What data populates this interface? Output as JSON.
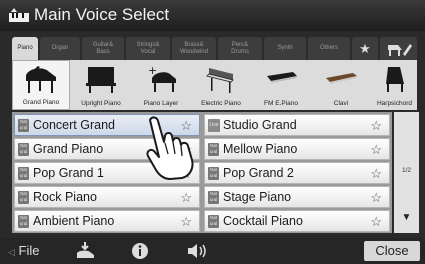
{
  "title": "Main Voice Select",
  "tabs": [
    {
      "label": "Piano",
      "active": true
    },
    {
      "label": "Organ",
      "active": false
    },
    {
      "label": "Guitar&\nBass",
      "active": false
    },
    {
      "label": "Strings&\nVocal",
      "active": false
    },
    {
      "label": "Brass&\nWoodwind",
      "active": false
    },
    {
      "label": "Perc&\nDrums",
      "active": false
    },
    {
      "label": "Synth",
      "active": false
    },
    {
      "label": "Others",
      "active": false
    }
  ],
  "categories": [
    {
      "label": "Grand Piano",
      "icon": "grand-piano-icon",
      "active": true
    },
    {
      "label": "Upright Piano",
      "icon": "upright-piano-icon"
    },
    {
      "label": "Piano Layer",
      "icon": "piano-layer-icon"
    },
    {
      "label": "Electric Piano",
      "icon": "electric-piano-icon"
    },
    {
      "label": "FM E.Piano",
      "icon": "fm-epiano-icon"
    },
    {
      "label": "Clavi",
      "icon": "clavi-icon"
    },
    {
      "label": "Harpsichord",
      "icon": "harpsichord-icon"
    }
  ],
  "voices_left": [
    {
      "name": "Concert Grand",
      "badge": "Nat\nural",
      "selected": true
    },
    {
      "name": "Grand Piano",
      "badge": "Nat\nural"
    },
    {
      "name": "Pop Grand 1",
      "badge": "Nat\nural"
    },
    {
      "name": "Rock Piano",
      "badge": "Nat\nural"
    },
    {
      "name": "Ambient Piano",
      "badge": "Nat\nural"
    }
  ],
  "voices_right": [
    {
      "name": "Studio Grand",
      "badge": "Live"
    },
    {
      "name": "Mellow Piano",
      "badge": "Nat\nural"
    },
    {
      "name": "Pop Grand 2",
      "badge": "Nat\nural"
    },
    {
      "name": "Stage Piano",
      "badge": "Nat\nural"
    },
    {
      "name": "Cocktail Piano",
      "badge": "Nat\nural"
    }
  ],
  "star_glyph": "☆",
  "page_indicator": "1/2",
  "page_down_glyph": "▼",
  "bottom": {
    "file_label": "File",
    "close_label": "Close"
  }
}
